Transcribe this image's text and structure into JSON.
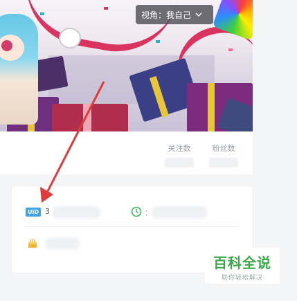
{
  "banner": {
    "view_label": "视角：我自己"
  },
  "profile": {
    "stats": [
      {
        "label": "关注数"
      },
      {
        "label": "粉丝数"
      }
    ]
  },
  "info": {
    "uid_badge": "UID",
    "uid_prefix": "3",
    "time_prefix": "："
  },
  "watermark": {
    "title": "百科全说",
    "subtitle": "助你轻松解决"
  },
  "colors": {
    "accent": "#40a4e5",
    "arrow": "#e03a3a",
    "watermark": "#3aa84a"
  }
}
